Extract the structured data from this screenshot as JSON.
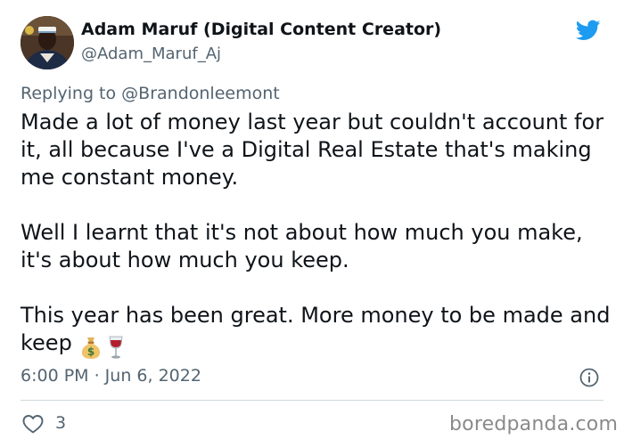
{
  "author": {
    "display_name": "Adam Maruf (Digital Content Creator)",
    "handle": "@Adam_Maruf_Aj"
  },
  "reply": {
    "prefix": "Replying to",
    "mention": "@Brandonleemont"
  },
  "tweet": {
    "text": "Made a lot of money last year but couldn't account for it, all because I've a Digital Real Estate that's making me constant money.\n\nWell I learnt that it's not about how much you make, it's about how much you keep.\n\nThis year has been great. More money to be made and keep",
    "emojis": [
      "money-bag-icon",
      "wine-glass-icon"
    ],
    "timestamp": "6:00 PM · Jun 6, 2022"
  },
  "actions": {
    "like_count": "3"
  },
  "watermark": "boredpanda.com",
  "colors": {
    "twitter_blue": "#1d9bf0",
    "secondary_text": "#536471",
    "divider": "#cfd9de"
  }
}
